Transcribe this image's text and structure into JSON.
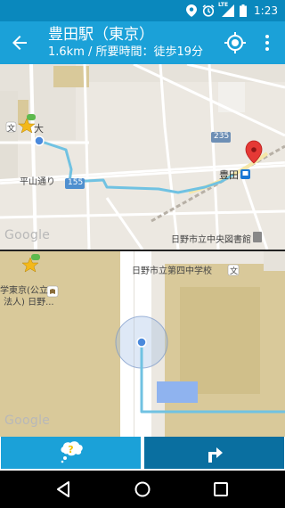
{
  "status_bar": {
    "time": "1:23",
    "icons": [
      "location-icon",
      "alarm-icon",
      "lte-signal-icon",
      "battery-icon"
    ],
    "network_label": "LTE"
  },
  "toolbar": {
    "title": "豊田駅（東京）",
    "subtitle": "1.6km / 所要時間：徒歩19分",
    "color": "#1ba1d8"
  },
  "map_top": {
    "labels": {
      "university_fragment": "大",
      "road_hirayama": "平山通り",
      "route_155": "155",
      "route_235": "235",
      "station": "豊田",
      "library": "日野市立中央図書館",
      "school_icon": "文"
    },
    "google": "Google"
  },
  "map_bottom": {
    "labels": {
      "school": "日野市立第四中学校",
      "school_icon": "文",
      "university_line1": "学東京(公立",
      "university_line2": "法人) 日野..."
    },
    "google": "Google"
  },
  "action_bar": {
    "help_icon_text": "?",
    "help_color": "#1ba1d8",
    "turn_color": "#0a6fa0"
  },
  "nav_bar": {
    "items": [
      "back-icon",
      "home-icon",
      "recents-icon"
    ]
  }
}
